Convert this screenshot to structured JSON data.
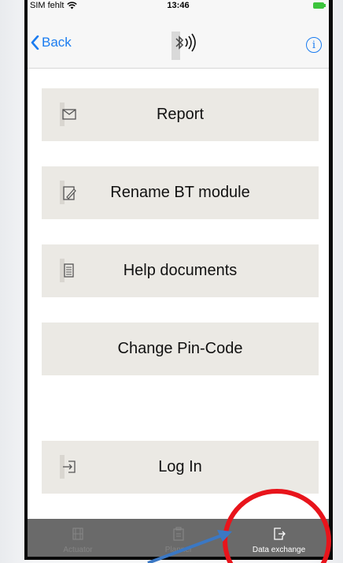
{
  "status": {
    "carrier": "SIM fehlt",
    "time": "13:46"
  },
  "nav": {
    "back_label": "Back",
    "info_glyph": "i"
  },
  "menu": [
    {
      "label": "Report",
      "icon": "envelope-icon"
    },
    {
      "label": "Rename BT module",
      "icon": "edit-icon"
    },
    {
      "label": "Help documents",
      "icon": "document-icon"
    },
    {
      "label": "Change Pin-Code",
      "icon": ""
    },
    {
      "label": "Log In",
      "icon": "login-icon"
    }
  ],
  "tabbar": [
    {
      "label": "Actuator",
      "icon": "actuator-icon",
      "active": false
    },
    {
      "label": "Planner",
      "icon": "clipboard-icon",
      "active": false
    },
    {
      "label": "Data exchange",
      "icon": "data-exchange-icon",
      "active": true
    }
  ],
  "colors": {
    "accent": "#1a7cf0",
    "button_bg": "#ebe9e4",
    "tabbar_bg": "#6a6a6a",
    "annotation_circle": "#e8141b",
    "annotation_arrow": "#3b78c4"
  }
}
